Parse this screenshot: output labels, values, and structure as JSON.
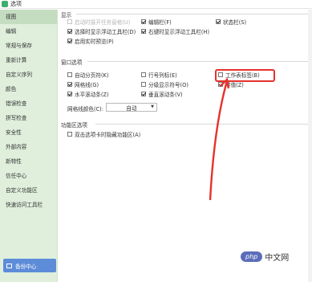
{
  "window": {
    "title": "选项"
  },
  "sidebar": {
    "items": [
      {
        "label": "视图",
        "active": true
      },
      {
        "label": "编辑"
      },
      {
        "label": "常规与保存"
      },
      {
        "label": "重新计算"
      },
      {
        "label": "自定义序列"
      },
      {
        "label": "颜色"
      },
      {
        "label": "错误检查"
      },
      {
        "label": "拼写检查"
      },
      {
        "label": "安全性"
      },
      {
        "label": "外部内容"
      },
      {
        "label": "新特性"
      },
      {
        "label": "信任中心"
      },
      {
        "label": "自定义功能区"
      },
      {
        "label": "快速访问工具栏"
      }
    ],
    "backup_label": "备份中心"
  },
  "display": {
    "title": "显示",
    "opt_taskbar": "启动时展开任务窗格(U)",
    "opt_formula_bar": "编辑栏(F)",
    "opt_status_bar": "状态栏(S)",
    "opt_float_toolbar_select": "选择时显示浮动工具栏(D)",
    "opt_float_toolbar_right": "右键时显示浮动工具栏(H)",
    "opt_live_preview": "启用实时预览(P)"
  },
  "window_options": {
    "title": "窗口选项",
    "opt_auto_page_break": "自动分页符(K)",
    "opt_row_col_header": "行号列标(E)",
    "opt_sheet_tabs": "工作表标签(B)",
    "opt_gridlines": "网格线(G)",
    "opt_outline": "分级显示符号(O)",
    "opt_zero": "零值(Z)",
    "opt_hscroll": "水平滚动条(Z)",
    "opt_vscroll": "垂直滚动条(V)",
    "gridline_color_label": "网格线颜色(C):",
    "gridline_color_value": "自动"
  },
  "ribbon_options": {
    "title": "功能区选项",
    "opt_dblclick_hide": "双击选项卡时隐藏功能区(A)"
  },
  "watermark": {
    "badge": "php",
    "text": "中文网"
  },
  "colors": {
    "sidebar_bg": "#dfefdc",
    "highlight": "#e5322d",
    "backup_button": "#5d8cd8"
  }
}
